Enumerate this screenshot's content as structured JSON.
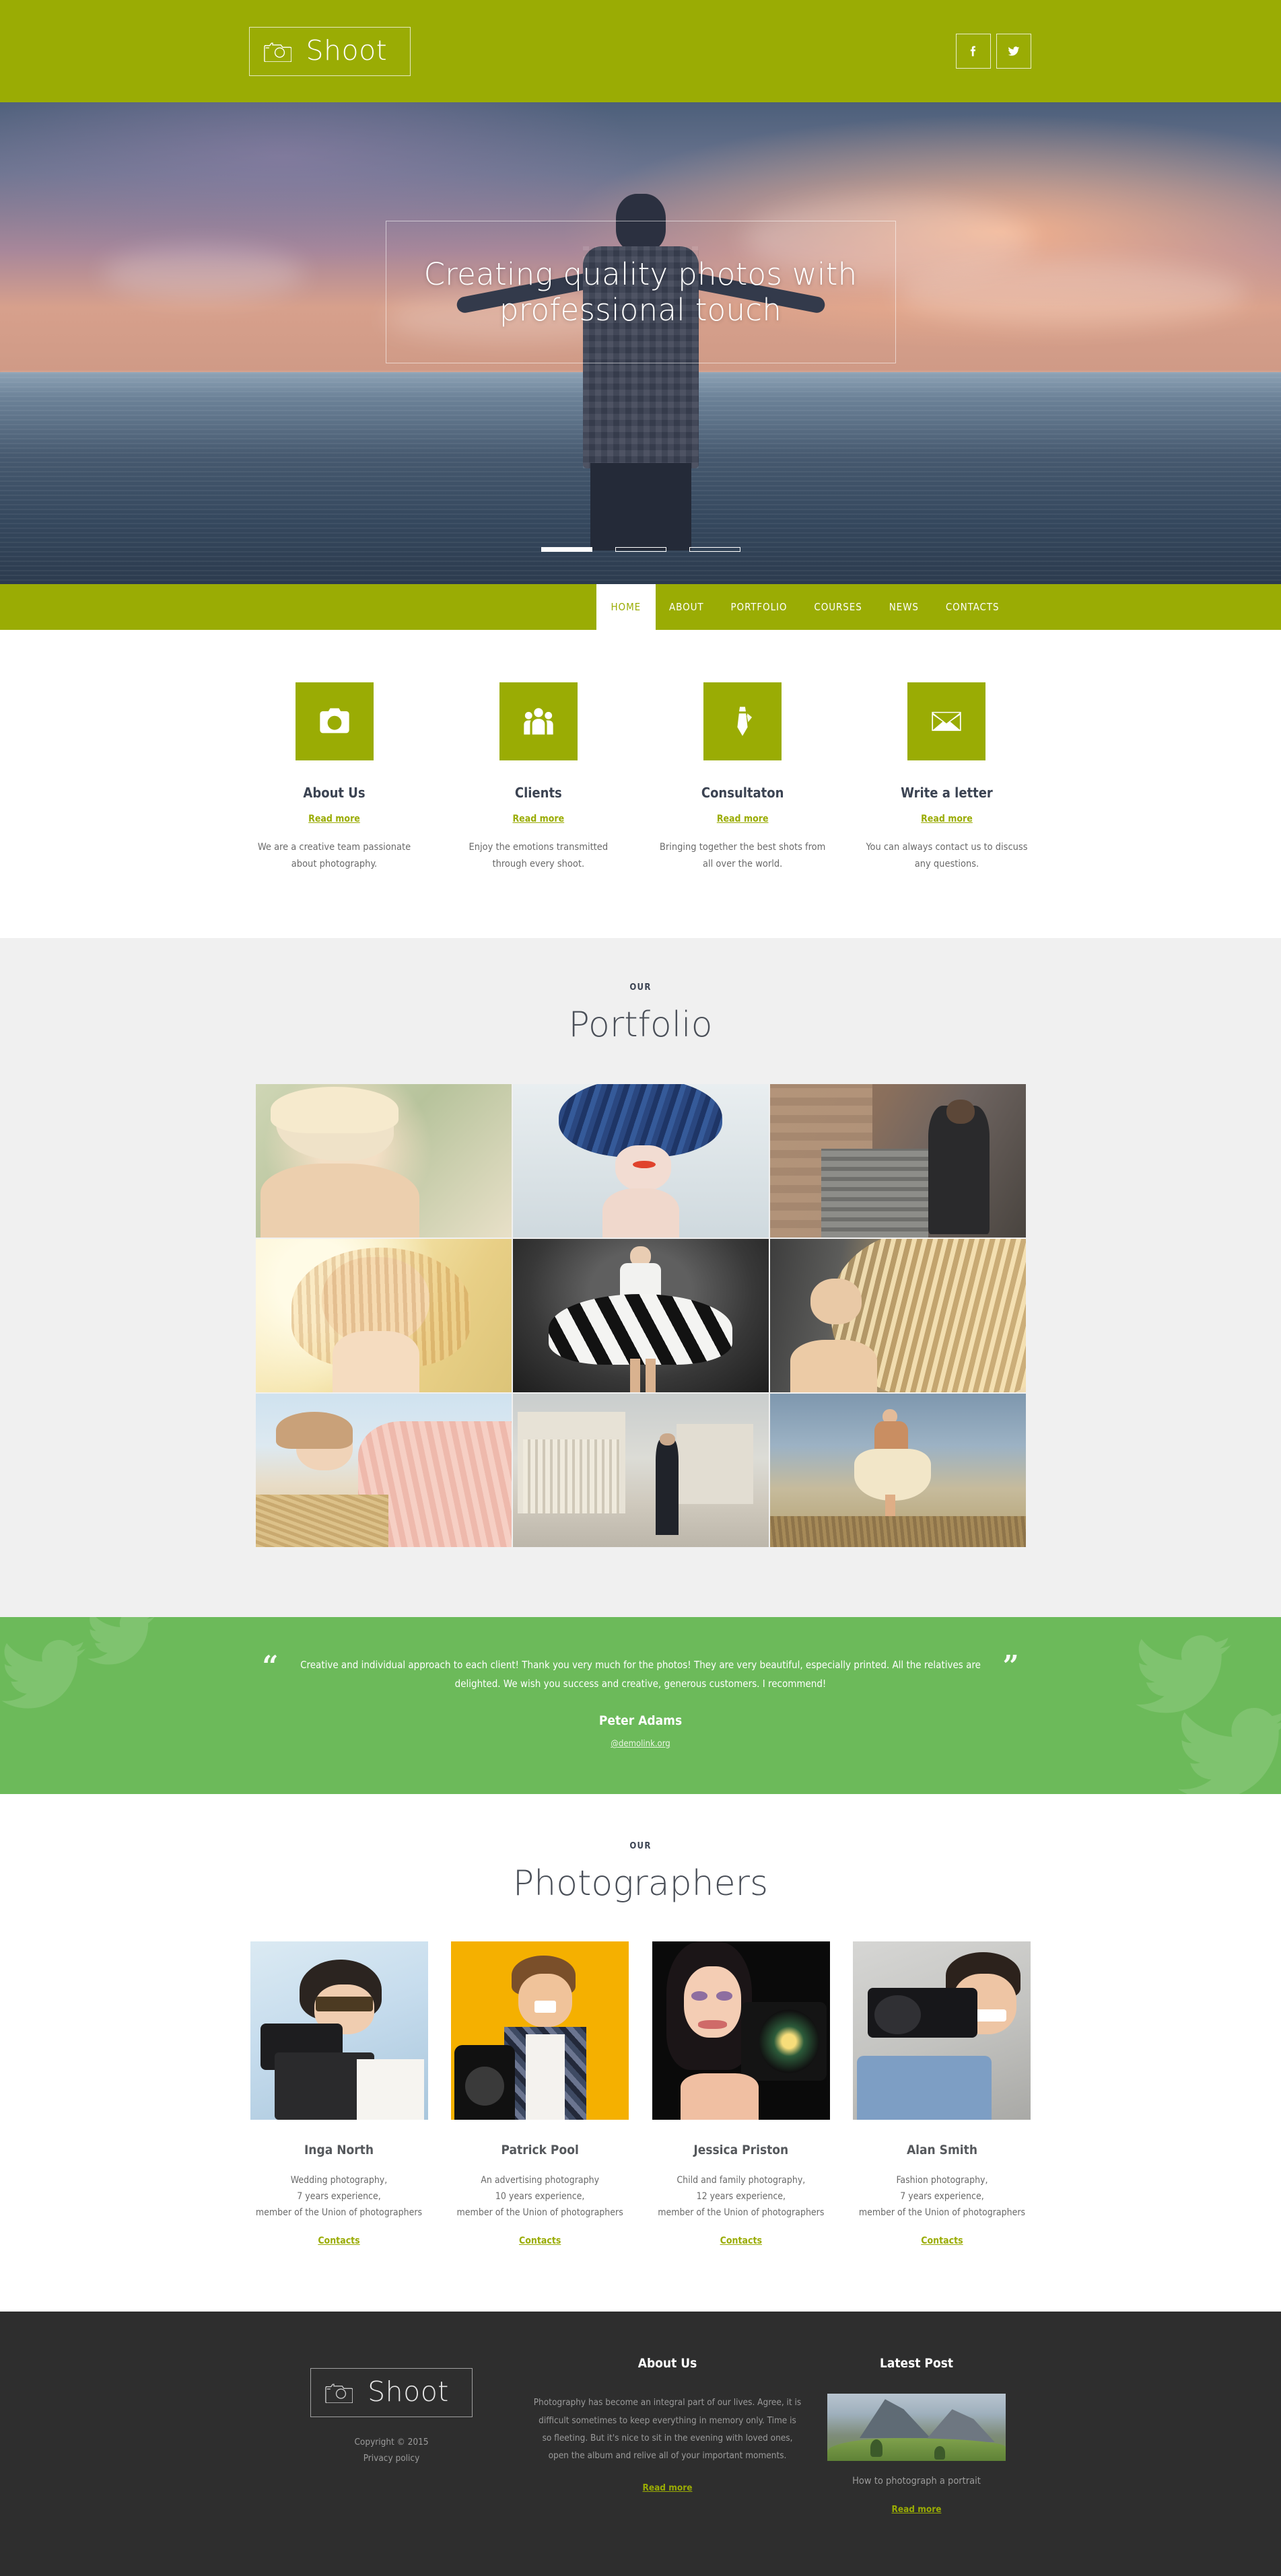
{
  "brand": {
    "name": "Shoot",
    "logo_icon": "camera-icon"
  },
  "header": {
    "social": [
      {
        "name": "facebook-icon",
        "label": "f"
      },
      {
        "name": "twitter-icon",
        "label": "t"
      }
    ]
  },
  "hero": {
    "headline": "Creating quality photos with professional touch",
    "slides": 3,
    "active_slide": 1
  },
  "nav": {
    "items": [
      {
        "label": "HOME",
        "active": true
      },
      {
        "label": "ABOUT",
        "active": false
      },
      {
        "label": "PORTFOLIO",
        "active": false
      },
      {
        "label": "COURSES",
        "active": false
      },
      {
        "label": "NEWS",
        "active": false
      },
      {
        "label": "CONTACTS",
        "active": false
      }
    ]
  },
  "services": [
    {
      "icon": "camera-icon",
      "title": "About Us",
      "link": "Read more",
      "text": "We are a creative team passionate about photography."
    },
    {
      "icon": "people-group-icon",
      "title": "Clients",
      "link": "Read more",
      "text": "Enjoy the emotions transmitted through every shoot."
    },
    {
      "icon": "necktie-icon",
      "title": "Consultaton",
      "link": "Read more",
      "text": "Bringing together the best shots from all over the world."
    },
    {
      "icon": "envelope-icon",
      "title": "Write a letter",
      "link": "Read more",
      "text": "You can always contact us to discuss any questions."
    }
  ],
  "portfolio": {
    "kicker": "OUR",
    "title": "Portfolio",
    "items": [
      {
        "caption": "Blonde model portrait"
      },
      {
        "caption": "Model with blue feather headdress"
      },
      {
        "caption": "Man in alley with stairs"
      },
      {
        "caption": "Backlit portrait golden hour"
      },
      {
        "caption": "Dancer in striped dress"
      },
      {
        "caption": "Flowing blonde hair close-up"
      },
      {
        "caption": "Woman in pink dress on hay"
      },
      {
        "caption": "Man in suit on city square"
      },
      {
        "caption": "Woman in dress on field"
      }
    ]
  },
  "testimonial": {
    "quote": "Creative and individual approach to each client! Thank you very much for the photos! They are very beautiful, especially printed. All the relatives are delighted. We wish you success and creative, generous customers. I recommend!",
    "author": "Peter Adams",
    "link": "@demolink.org",
    "open_quote": "“",
    "close_quote": "”"
  },
  "team": {
    "kicker": "OUR",
    "title": "Photographers",
    "members": [
      {
        "name": "Inga North",
        "bio": "Wedding photography,\n7 years experience,\nmember of the Union of photographers",
        "link": "Contacts"
      },
      {
        "name": "Patrick Pool",
        "bio": "An advertising photography\n10 years experience,\nmember of the Union of photographers",
        "link": "Contacts"
      },
      {
        "name": "Jessica Priston",
        "bio": "Child and family photography,\n12 years experience,\nmember of the Union of photographers",
        "link": "Contacts"
      },
      {
        "name": "Alan Smith",
        "bio": "Fashion photography,\n7 years experience,\nmember of the Union of photographers",
        "link": "Contacts"
      }
    ]
  },
  "footer": {
    "copyright": "Copyright © 2015",
    "privacy": "Privacy policy",
    "about": {
      "title": "About Us",
      "text": "Photography has become an integral part of our lives. Agree, it is difficult sometimes to keep everything in memory only. Time is so fleeting. But it's nice to sit in the evening with loved ones, open the album and relive all of your important moments.",
      "link": "Read more"
    },
    "post": {
      "title": "Latest Post",
      "headline": "How to photograph a portrait",
      "link": "Read more",
      "thumb_caption": "Mountain landscape with green meadow"
    }
  },
  "colors": {
    "brand_green": "#9aac04",
    "testimonial_green": "#6cba5a",
    "footer_dark": "#2e2e2e",
    "portfolio_bg": "#f0f0f0"
  }
}
